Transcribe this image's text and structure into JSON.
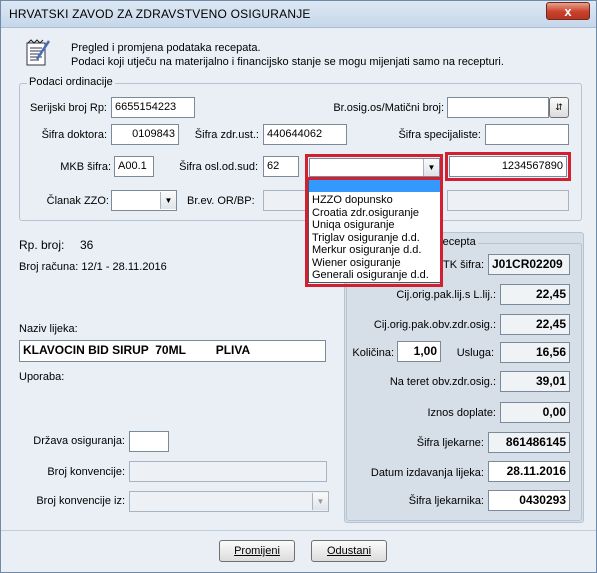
{
  "window": {
    "title": "HRVATSKI ZAVOD ZA ZDRAVSTVENO OSIGURANJE",
    "close_glyph": "x"
  },
  "info": {
    "line1": "Pregled i promjena podataka recepata.",
    "line2": "Podaci koji utječu na materijalno i financijsko stanje se mogu mijenjati samo na recepturi."
  },
  "ordinacija": {
    "group_title": "Podaci ordinacije",
    "serijski_label": "Serijski broj Rp:",
    "serijski_value": "6655154223",
    "brosig_label": "Br.osig.os/Matični broj:",
    "brosig_value": "",
    "sifra_doktora_label": "Šifra doktora:",
    "sifra_doktora_value": "0109843",
    "sifra_zdr_label": "Šifra zdr.ust.:",
    "sifra_zdr_value": "440644062",
    "sifra_spec_label": "Šifra specijaliste:",
    "sifra_spec_value": "",
    "mkb_label": "MKB šifra:",
    "mkb_value": "A00.1",
    "sifra_osl_label": "Šifra osl.od.sud:",
    "sifra_osl_value": "62",
    "osiguranje_value": "",
    "police_value": "1234567890",
    "clanak_label": "Članak ZZO:",
    "clanak_value": "",
    "brev_label": "Br.ev. OR/BP:"
  },
  "dropdown": {
    "options": [
      "",
      "HZZO dopunsko",
      "Croatia zdr.osiguranje",
      "Uniqa osiguranje",
      "Triglav osiguranje d.d.",
      "Merkur osiguranje d.d.",
      "Wiener osiguranje",
      "Generali osiguranje d.d."
    ]
  },
  "recept": {
    "rp_broj_label": "Rp. broj:",
    "rp_broj_value": "36",
    "broj_racuna": "Broj računa: 12/1 - 28.11.2016",
    "naziv_label": "Naziv lijeka:",
    "naziv_value": "KLAVOCIN BID SIRUP  70ML         PLIVA",
    "uporaba_label": "Uporaba:",
    "drzava_label": "Država osiguranja:",
    "drzava_value": "",
    "konvencija_label": "Broj konvencije:",
    "konvencija_value": "",
    "konvencija_iz_label": "Broj konvencije iz:",
    "konvencija_iz_value": ""
  },
  "podaci_recepta": {
    "group_title": "recepta",
    "atk_label": "TK šifra:",
    "atk_value": "J01CR02209",
    "cij_orig_label": "Cij.orig.pak.lij.s L.lij.:",
    "cij_orig_value": "22,45",
    "cij_obv_label": "Cij.orig.pak.obv.zdr.osig.:",
    "cij_obv_value": "22,45",
    "kolicina_label": "Količina:",
    "kolicina_value": "1,00",
    "usluga_label": "Usluga:",
    "usluga_value": "16,56",
    "na_teret_label": "Na teret obv.zdr.osig.:",
    "na_teret_value": "39,01",
    "doplata_label": "Iznos doplate:",
    "doplata_value": "0,00",
    "sifra_ljek_label": "Šifra ljekarne:",
    "sifra_ljek_value": "861486145",
    "datum_label": "Datum izdavanja lijeka:",
    "datum_value": "28.11.2016",
    "sifra_ljekarnika_label": "Šifra ljekarnika:",
    "sifra_ljekarnika_value": "0430293"
  },
  "buttons": {
    "promijeni": "Promijeni",
    "odustani": "Odustani"
  },
  "colors": {
    "window_bg": "#e9eff5",
    "highlight": "#d32030",
    "selection": "#3399ff"
  }
}
